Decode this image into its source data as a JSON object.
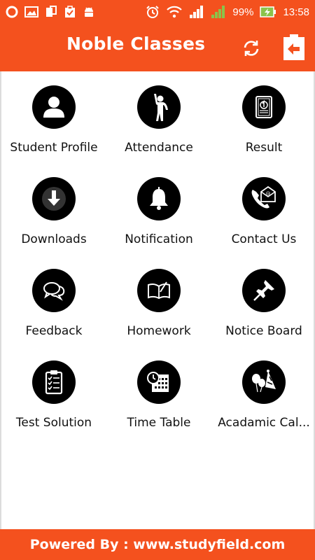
{
  "status_bar": {
    "battery": "99%",
    "time": "13:58",
    "left_icons": [
      "opera-icon",
      "gallery-icon",
      "sim-icon",
      "clipboard-icon",
      "android-icon"
    ],
    "right_icons": [
      "alarm-icon",
      "wifi-icon",
      "signal-icon",
      "signal-2-icon",
      "battery-charging-icon"
    ]
  },
  "app_bar": {
    "title": "Noble Classes",
    "refresh_icon": "refresh-icon",
    "logout_icon": "logout-icon"
  },
  "menu": [
    {
      "label": "Student Profile",
      "icon": "user-icon"
    },
    {
      "label": "Attendance",
      "icon": "raised-hand-person-icon"
    },
    {
      "label": "Result",
      "icon": "report-card-icon"
    },
    {
      "label": "Downloads",
      "icon": "download-arrow-icon"
    },
    {
      "label": "Notification",
      "icon": "bell-icon"
    },
    {
      "label": "Contact Us",
      "icon": "phone-mail-icon"
    },
    {
      "label": "Feedback",
      "icon": "chat-bubbles-icon"
    },
    {
      "label": "Homework",
      "icon": "open-book-icon"
    },
    {
      "label": "Notice Board",
      "icon": "pushpin-icon"
    },
    {
      "label": "Test Solution",
      "icon": "checklist-clipboard-icon"
    },
    {
      "label": "Time Table",
      "icon": "clock-calendar-icon"
    },
    {
      "label": "Acadamic Cal...",
      "icon": "party-balloons-icon"
    }
  ],
  "footer": {
    "text": "Powered By : www.studyfield.com"
  },
  "colors": {
    "primary": "#f4511e",
    "icon_circle": "#000000",
    "text": "#111111"
  }
}
